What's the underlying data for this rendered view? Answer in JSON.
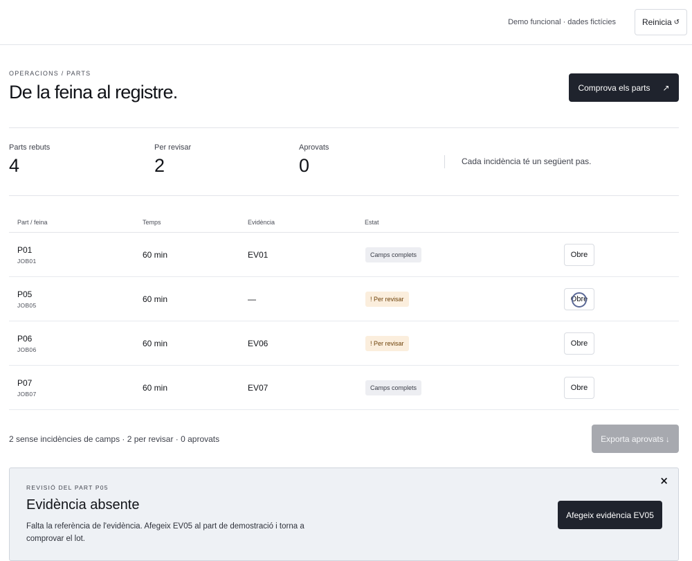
{
  "topbar": {
    "demo_label": "Demo funcional · dades fictícies",
    "reset_label": "Reinicia",
    "reset_icon": "↺"
  },
  "header": {
    "kicker": "OPERACIONS / PARTS",
    "title": "De la feina al registre.",
    "check_label": "Comprova els parts",
    "check_icon": "↗"
  },
  "stats": [
    {
      "label": "Parts rebuts",
      "value": "4"
    },
    {
      "label": "Per revisar",
      "value": "2"
    },
    {
      "label": "Aprovats",
      "value": "0"
    }
  ],
  "stats_note": "Cada incidència té un següent pas.",
  "table": {
    "columns": [
      "Part / feina",
      "Temps",
      "Evidència",
      "Estat"
    ],
    "rows": [
      {
        "id": "P01",
        "job": "JOB01",
        "time": "60 min",
        "evidence": "EV01",
        "status": "Camps complets",
        "status_type": "ok",
        "action": "Obre"
      },
      {
        "id": "P05",
        "job": "JOB05",
        "time": "60 min",
        "evidence": "—",
        "status": "! Per revisar",
        "status_type": "warn",
        "action": "Obre"
      },
      {
        "id": "P06",
        "job": "JOB06",
        "time": "60 min",
        "evidence": "EV06",
        "status": "! Per revisar",
        "status_type": "warn",
        "action": "Obre"
      },
      {
        "id": "P07",
        "job": "JOB07",
        "time": "60 min",
        "evidence": "EV07",
        "status": "Camps complets",
        "status_type": "ok",
        "action": "Obre"
      }
    ]
  },
  "footer": {
    "summary": "2 sense incidències de camps · 2 per revisar · 0 aprovats",
    "export_label": "Exporta aprovats",
    "export_icon": "↓"
  },
  "review_panel": {
    "kicker": "REVISIÓ DEL PART P05",
    "title": "Evidència absente",
    "body": "Falta la referència de l'evidència. Afegeix EV05 al part de demostració i torna a comprovar el lot.",
    "close_icon": "×",
    "action_label": "Afegeix evidència EV05"
  },
  "colors": {
    "primary_dark": "#1f232d",
    "warn_bg": "#fbeedd",
    "ok_bg": "#edeef2",
    "panel_bg": "#eef1f5",
    "disabled": "#a7a9af"
  }
}
